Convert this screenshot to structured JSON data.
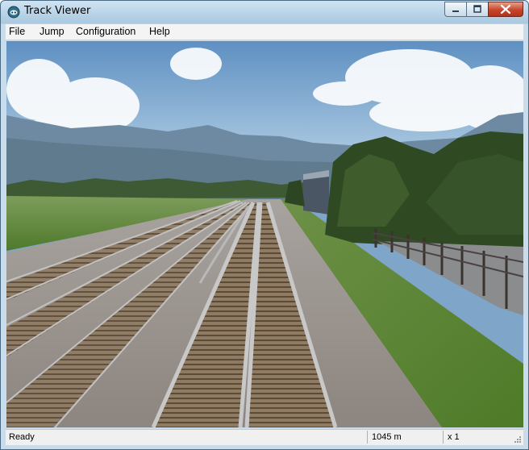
{
  "window": {
    "title": "Track Viewer"
  },
  "menu": {
    "items": [
      "File",
      "Jump",
      "Configuration",
      "Help"
    ]
  },
  "status": {
    "state": "Ready",
    "distance": "1045 m",
    "speed": "x 1"
  },
  "icons": {
    "app": "track-viewer-app-icon",
    "minimize": "minimize-icon",
    "maximize": "maximize-icon",
    "close": "close-icon"
  },
  "colors": {
    "sky": "#8fb4d6",
    "grass": "#5e8a3a",
    "ballast": "#9a9290",
    "rail": "#bcbcbc"
  }
}
